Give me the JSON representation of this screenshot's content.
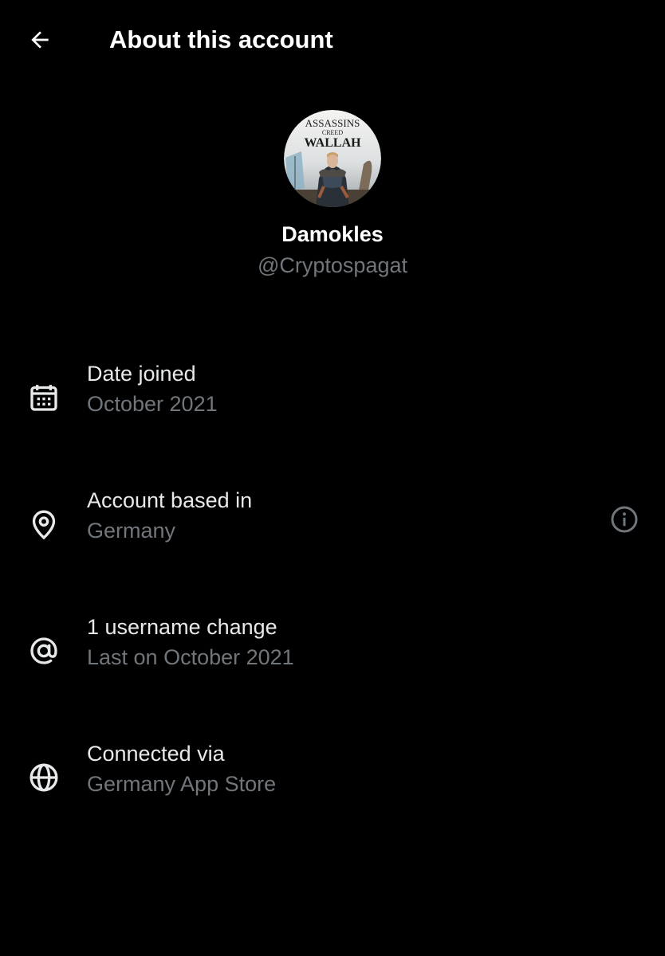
{
  "header": {
    "title": "About this account",
    "back_icon": "arrow-left-icon"
  },
  "profile": {
    "display_name": "Damokles",
    "handle": "@Cryptospagat",
    "avatar": {
      "line1": "ASSASSINS",
      "line2": "CREED",
      "line3": "WALLAH"
    }
  },
  "rows": [
    {
      "icon": "calendar-icon",
      "title": "Date joined",
      "subtitle": "October 2021"
    },
    {
      "icon": "location-pin-icon",
      "title": "Account based in",
      "subtitle": "Germany",
      "trailing_icon": "info-icon"
    },
    {
      "icon": "at-sign-icon",
      "title": "1 username change",
      "subtitle": "Last on October 2021"
    },
    {
      "icon": "globe-icon",
      "title": "Connected via",
      "subtitle": "Germany App Store"
    }
  ],
  "colors": {
    "background": "#000000",
    "primary_text": "#e7e9ea",
    "secondary_text": "#71767b"
  }
}
